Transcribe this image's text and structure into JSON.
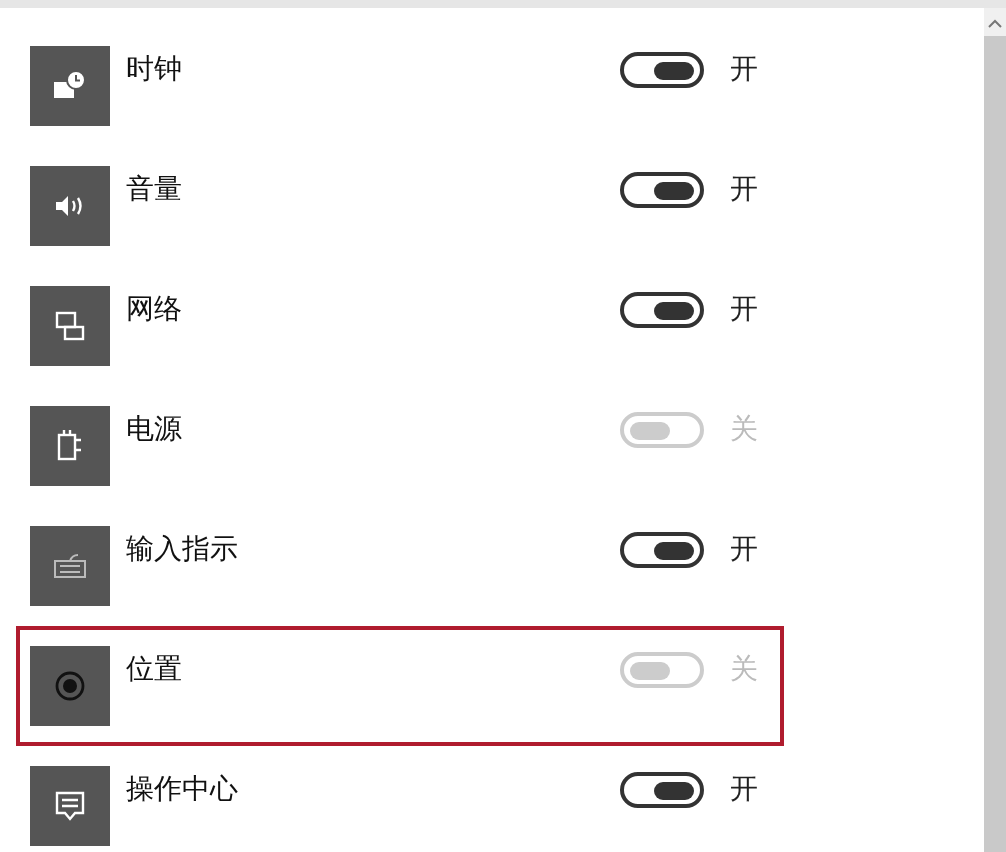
{
  "items": [
    {
      "label": "时钟",
      "on": true,
      "state": "开",
      "highlighted": false
    },
    {
      "label": "音量",
      "on": true,
      "state": "开",
      "highlighted": false
    },
    {
      "label": "网络",
      "on": true,
      "state": "开",
      "highlighted": false
    },
    {
      "label": "电源",
      "on": false,
      "state": "关",
      "highlighted": false
    },
    {
      "label": "输入指示",
      "on": true,
      "state": "开",
      "highlighted": false
    },
    {
      "label": "位置",
      "on": false,
      "state": "关",
      "highlighted": true
    },
    {
      "label": "操作中心",
      "on": true,
      "state": "开",
      "highlighted": false
    }
  ]
}
